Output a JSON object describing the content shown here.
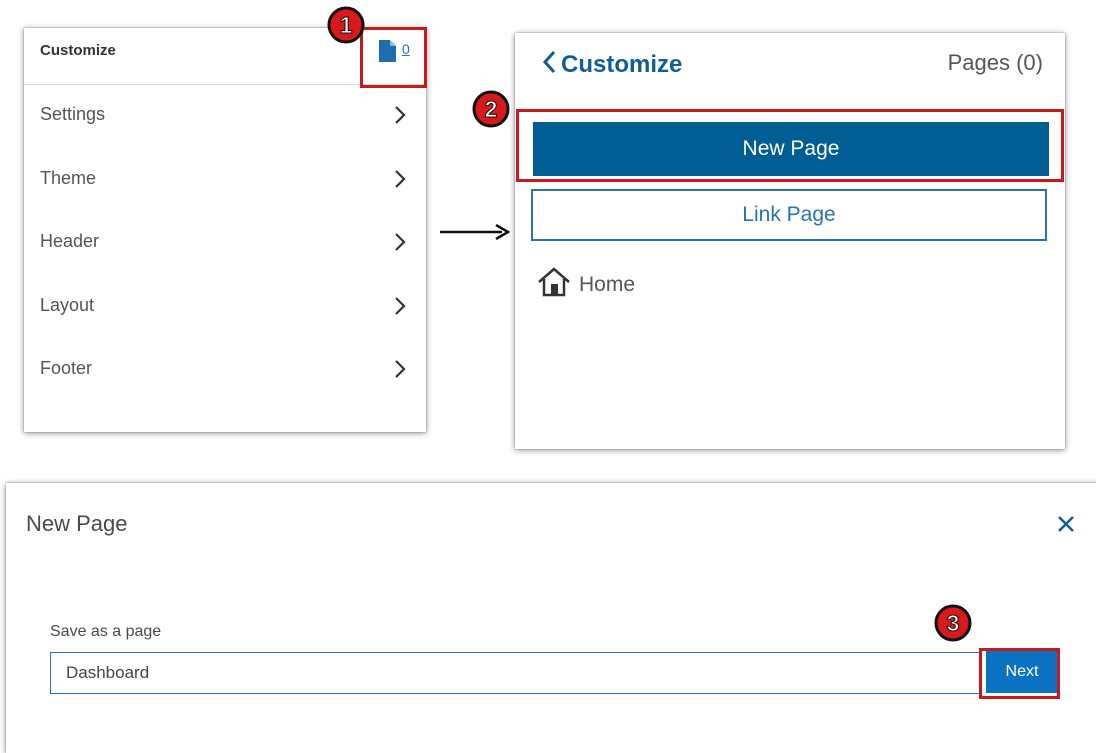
{
  "customize_panel": {
    "title": "Customize",
    "pages_count": "0",
    "menu_items": [
      {
        "label": "Settings"
      },
      {
        "label": "Theme"
      },
      {
        "label": "Header"
      },
      {
        "label": "Layout"
      },
      {
        "label": "Footer"
      }
    ]
  },
  "pages_panel": {
    "back_label": "Customize",
    "pages_label": "Pages (0)",
    "new_page_label": "New Page",
    "link_page_label": "Link Page",
    "home_label": "Home"
  },
  "new_page_dialog": {
    "title": "New Page",
    "field_label": "Save as a page",
    "field_value": "Dashboard",
    "next_label": "Next"
  },
  "annotations": {
    "step_numbers": [
      "1",
      "2",
      "3"
    ],
    "highlight_color": "#c8191c"
  },
  "colors": {
    "primary_blue": "#005e95",
    "link_blue": "#2a72b0",
    "next_blue": "#0b73c2"
  },
  "icons": [
    "document-icon",
    "chevron-right-icon",
    "chevron-left-icon",
    "home-icon",
    "close-icon",
    "arrow-right-icon"
  ]
}
